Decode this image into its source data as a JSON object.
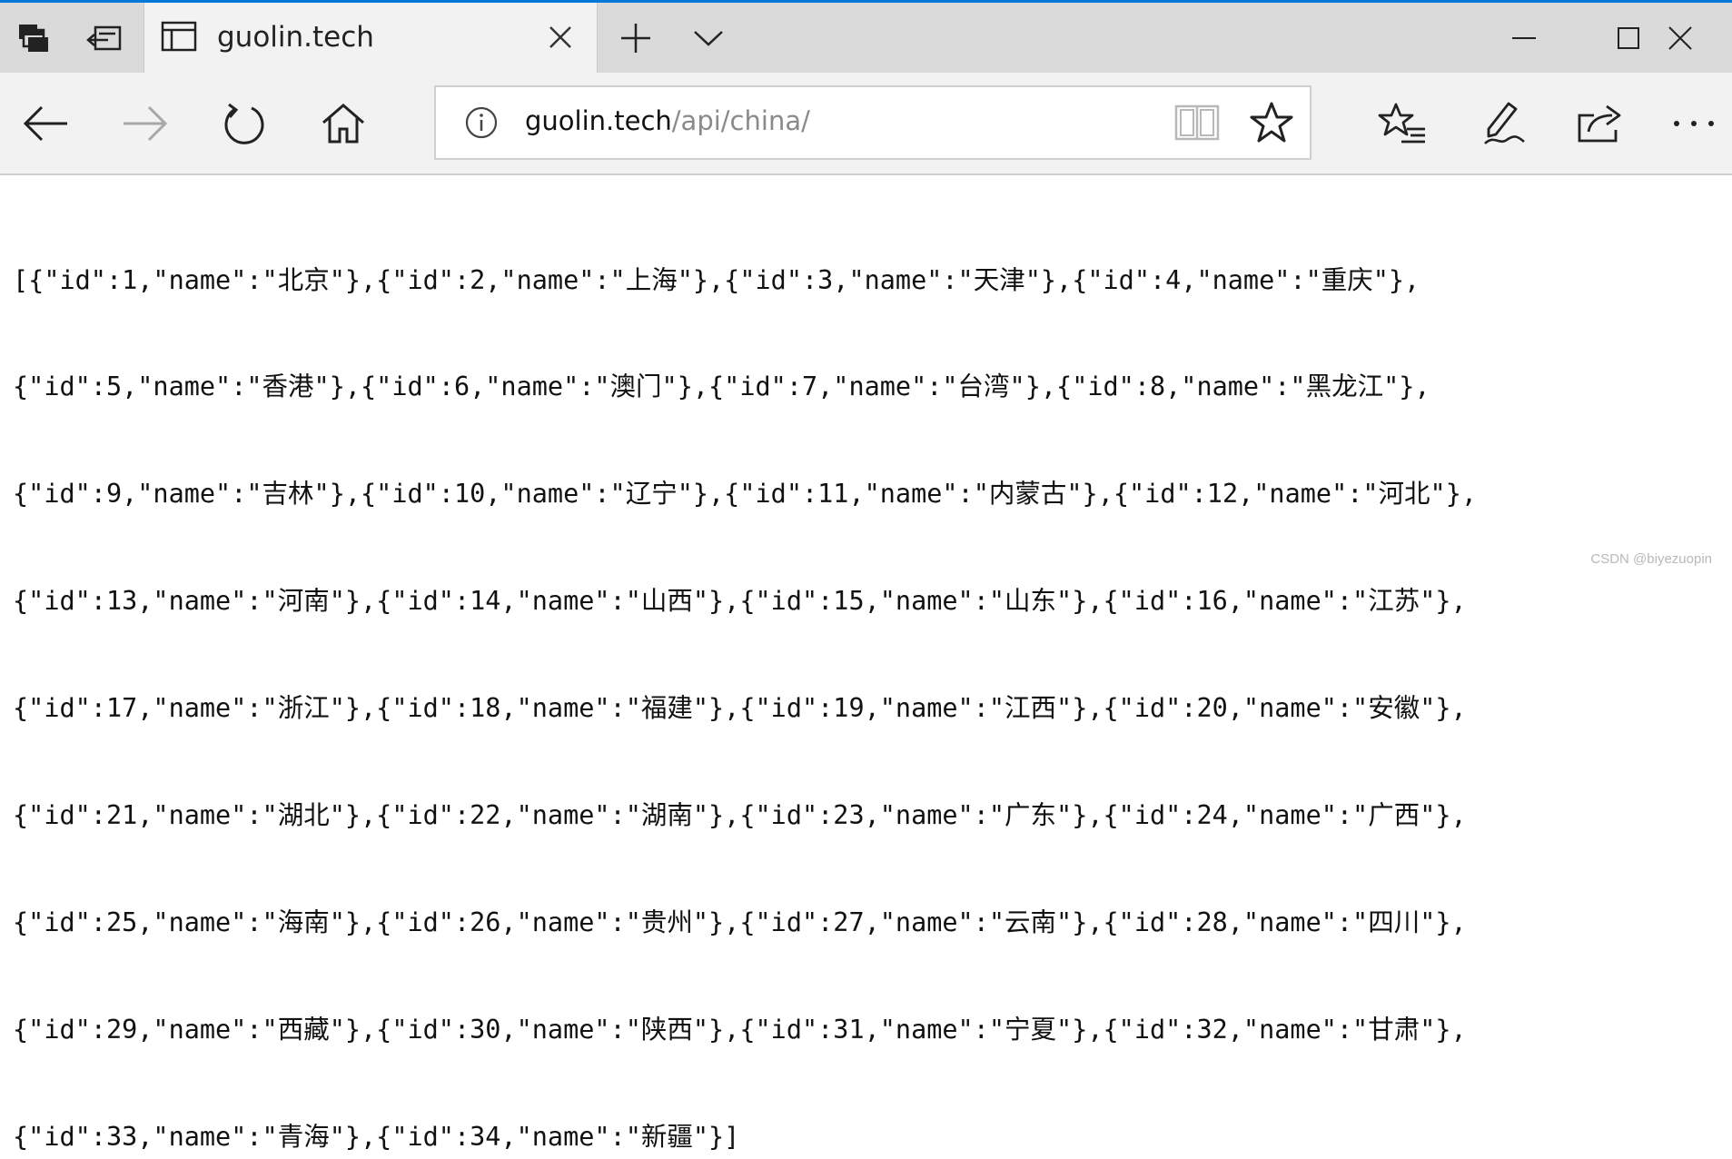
{
  "tab": {
    "title": "guolin.tech"
  },
  "address": {
    "host": "guolin.tech",
    "path": "/api/china/"
  },
  "content": {
    "lines": [
      "[{\"id\":1,\"name\":\"北京\"},{\"id\":2,\"name\":\"上海\"},{\"id\":3,\"name\":\"天津\"},{\"id\":4,\"name\":\"重庆\"},",
      "{\"id\":5,\"name\":\"香港\"},{\"id\":6,\"name\":\"澳门\"},{\"id\":7,\"name\":\"台湾\"},{\"id\":8,\"name\":\"黑龙江\"},",
      "{\"id\":9,\"name\":\"吉林\"},{\"id\":10,\"name\":\"辽宁\"},{\"id\":11,\"name\":\"内蒙古\"},{\"id\":12,\"name\":\"河北\"},",
      "{\"id\":13,\"name\":\"河南\"},{\"id\":14,\"name\":\"山西\"},{\"id\":15,\"name\":\"山东\"},{\"id\":16,\"name\":\"江苏\"},",
      "{\"id\":17,\"name\":\"浙江\"},{\"id\":18,\"name\":\"福建\"},{\"id\":19,\"name\":\"江西\"},{\"id\":20,\"name\":\"安徽\"},",
      "{\"id\":21,\"name\":\"湖北\"},{\"id\":22,\"name\":\"湖南\"},{\"id\":23,\"name\":\"广东\"},{\"id\":24,\"name\":\"广西\"},",
      "{\"id\":25,\"name\":\"海南\"},{\"id\":26,\"name\":\"贵州\"},{\"id\":27,\"name\":\"云南\"},{\"id\":28,\"name\":\"四川\"},",
      "{\"id\":29,\"name\":\"西藏\"},{\"id\":30,\"name\":\"陕西\"},{\"id\":31,\"name\":\"宁夏\"},{\"id\":32,\"name\":\"甘肃\"},",
      "{\"id\":33,\"name\":\"青海\"},{\"id\":34,\"name\":\"新疆\"}]"
    ]
  },
  "watermark": "CSDN @biyezuopin",
  "icons": {
    "tab_actions": "tab-actions-icon",
    "set_aside": "set-aside-tabs-icon",
    "page": "page-icon",
    "close_tab": "close-icon",
    "new_tab": "plus-icon",
    "tab_preview": "chevron-down-icon",
    "minimize": "minimize-icon",
    "maximize": "maximize-icon",
    "close_window": "close-icon",
    "back": "arrow-left-icon",
    "forward": "arrow-right-icon",
    "refresh": "refresh-icon",
    "home": "home-icon",
    "info": "info-icon",
    "reading_view": "book-icon",
    "favorite": "star-icon",
    "favorites_hub": "favorites-list-icon",
    "web_note": "pen-icon",
    "share": "share-icon",
    "more": "ellipsis-icon"
  },
  "colors": {
    "accent": "#0078d7",
    "titlebar": "#dadada",
    "toolbar": "#f2f2f2",
    "url_path": "#8a8a8a"
  }
}
